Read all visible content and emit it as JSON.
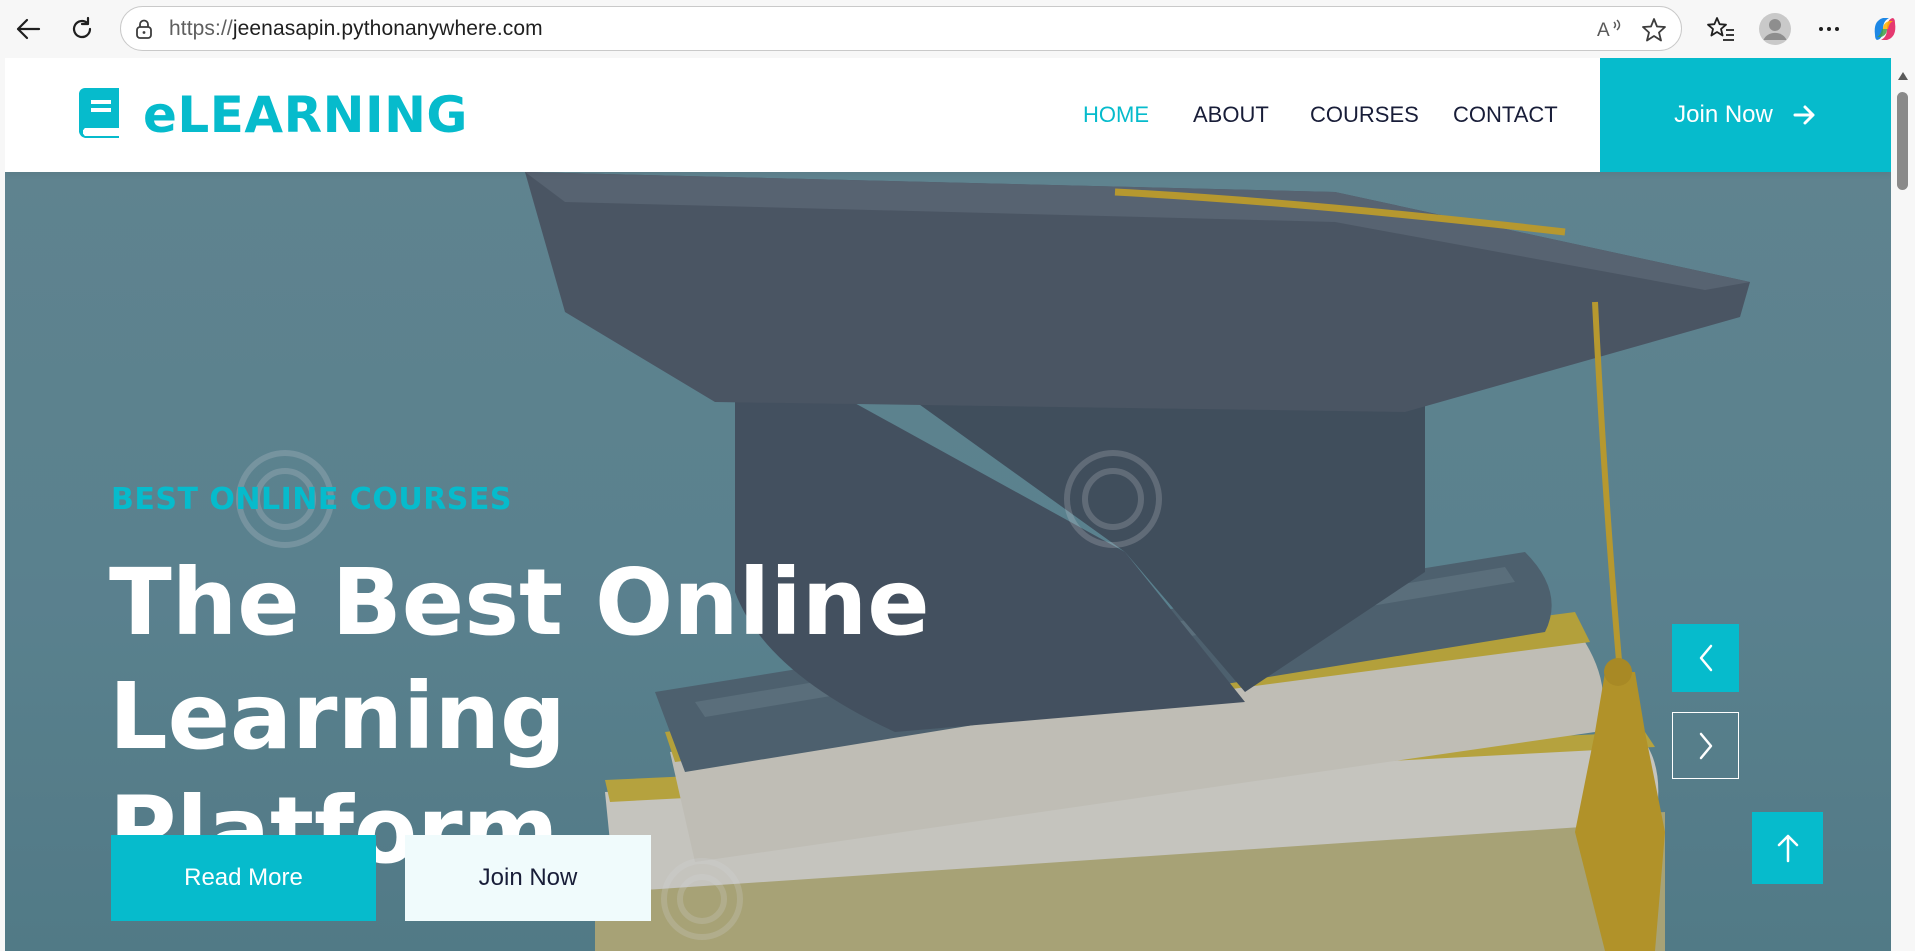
{
  "browser": {
    "url_scheme": "https://",
    "url_host": "jeenasapin.pythonanywhere.com",
    "icons": [
      "back-icon",
      "refresh-icon",
      "lock-icon",
      "read-aloud-icon",
      "favorite-star-icon",
      "favorites-icon",
      "profile-icon",
      "more-icon",
      "copilot-icon"
    ]
  },
  "site": {
    "brand": "eLEARNING",
    "nav": {
      "home": "HOME",
      "about": "ABOUT",
      "courses": "COURSES",
      "contact": "CONTACT"
    },
    "join_cta": "Join Now"
  },
  "hero": {
    "eyebrow": "BEST ONLINE COURSES",
    "title_line1": "The Best Online",
    "title_line2": "Learning Platform",
    "read_more": "Read More",
    "join_now": "Join Now"
  },
  "colors": {
    "accent": "#06bbcc",
    "dark": "#181d38",
    "light": "#f0fbfc"
  }
}
